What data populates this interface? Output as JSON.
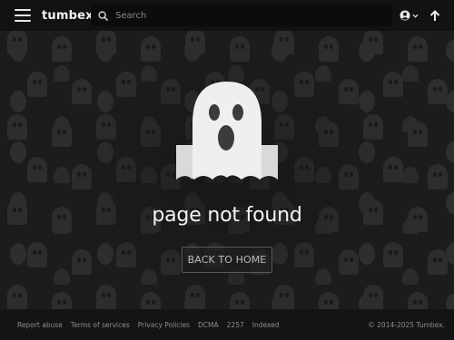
{
  "header": {
    "logo": "tumbex",
    "search_placeholder": "Search",
    "menu_icon": "hamburger-menu-icon",
    "search_icon": "search-icon",
    "account_icon": "user-circle-icon",
    "up_icon": "arrow-up-icon"
  },
  "main": {
    "illustration_icon": "ghost-icon",
    "title": "page not found",
    "back_button": "BACK TO HOME"
  },
  "footer": {
    "links": [
      "Report abuse",
      "Terms of services",
      "Privacy Policies",
      "DCMA",
      "2257",
      "Indexed"
    ],
    "copyright": "© 2014-2025 Tumbex."
  },
  "colors": {
    "background": "#1b1b1b",
    "header": "#121212",
    "footer": "#141414",
    "text": "#f4f4f4"
  }
}
